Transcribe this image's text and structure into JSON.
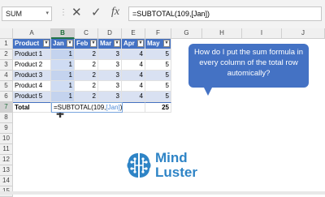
{
  "formula_bar": {
    "name_box": "SUM",
    "name_dropdown": "▾",
    "separator": "⋮",
    "cancel_icon": "✕",
    "enter_icon": "✓",
    "fx_label": "fx",
    "formula": "=SUBTOTAL(109,[Jan])"
  },
  "columns": [
    "A",
    "B",
    "C",
    "D",
    "E",
    "F",
    "G",
    "H",
    "I",
    "J"
  ],
  "row_numbers": [
    "1",
    "2",
    "3",
    "4",
    "5",
    "6",
    "7",
    "8",
    "9",
    "10",
    "11",
    "12",
    "13",
    "14",
    "15"
  ],
  "table": {
    "headers": [
      "Product",
      "Jan",
      "Feb",
      "Mar",
      "Apr",
      "May"
    ],
    "rows": [
      [
        "Product 1",
        "1",
        "2",
        "3",
        "4",
        "5"
      ],
      [
        "Product 2",
        "1",
        "2",
        "3",
        "4",
        "5"
      ],
      [
        "Product 3",
        "1",
        "2",
        "3",
        "4",
        "5"
      ],
      [
        "Product 4",
        "1",
        "2",
        "3",
        "4",
        "5"
      ],
      [
        "Product 5",
        "1",
        "2",
        "3",
        "4",
        "5"
      ]
    ],
    "total_label": "Total",
    "total_formula_prefix": "=SUBTOTAL(109,",
    "total_formula_ref": "[Jan]",
    "total_formula_suffix": ")",
    "total_may": "25"
  },
  "callout": {
    "text": "How do I put the sum formula in every column of the total row automically?"
  },
  "logo": {
    "line1": "Mind",
    "line2": "Luster"
  },
  "colors": {
    "table_header": "#4472c4",
    "band": "#d9e1f2",
    "callout": "#4472c4",
    "logo": "#2e84c6"
  }
}
